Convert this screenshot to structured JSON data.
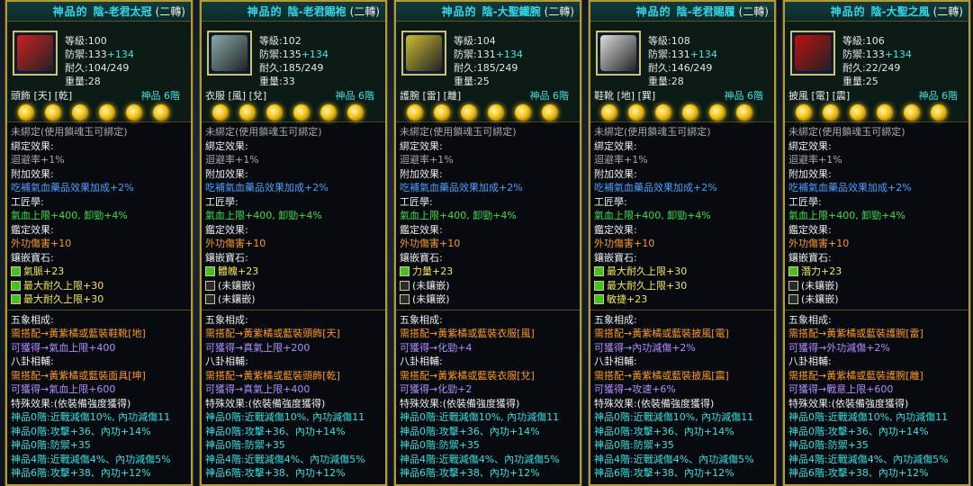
{
  "cards": [
    {
      "quality": "神品的",
      "name": "陰-老君太冠",
      "rebirth": "(二轉)",
      "icon_color": "#c22",
      "stats": {
        "level": "等級:100",
        "def": "防禦:133",
        "def_plus": "+134",
        "dur": "耐久:104/249",
        "weight": "重量:28"
      },
      "slot": "頭飾 [天] [乾]",
      "tier": "神品 6階",
      "unbound": "未綁定(使用鎖魂玉可綁定)",
      "bind_label": "綁定效果:",
      "bind_val": "迴避率+1%",
      "add_label": "附加效果:",
      "add_val": "吃補氣血藥品效果加成+2%",
      "craft_label": "工匠學:",
      "craft_val": "氣血上限+400, 卸勁+4%",
      "ident_label": "鑑定效果:",
      "ident_val": "外功傷害+10",
      "gem_label": "鑲嵌寶石:",
      "gems": [
        {
          "t": "氣脈+23",
          "on": true
        },
        {
          "t": "最大耐久上限+30",
          "on": true
        },
        {
          "t": "最大耐久上限+30",
          "on": true
        }
      ],
      "wx": "五象相成:",
      "wx1": "需搭配→黃紫橘或藍裝鞋靴[地]",
      "wx2": "可獲得→氣血上限+400",
      "bg": "八卦相輔:",
      "bg1": "需搭配→黃紫橘或藍裝面具[坤]",
      "bg2": "可獲得→氣血上限+600",
      "sp": "特殊效果:(依裝備強度獲得)",
      "sps": [
        "神品0階:近戰減傷10%, 內功減傷11",
        "神品0階:攻擊+36、內功+14%",
        "神品0階:防禦+35",
        "神品4階:近戰減傷4%、內功減傷5%",
        "神品6階:攻擊+38、內功+12%"
      ]
    },
    {
      "quality": "神品的",
      "name": "陰-老君賜袍",
      "rebirth": "(二轉)",
      "icon_color": "#8aa",
      "stats": {
        "level": "等級:102",
        "def": "防禦:135",
        "def_plus": "+134",
        "dur": "耐久:185/249",
        "weight": "重量:33"
      },
      "slot": "衣服 [風] [兌]",
      "tier": "神品 6階",
      "unbound": "未綁定(使用鎖魂玉可綁定)",
      "bind_label": "綁定效果:",
      "bind_val": "迴避率+1%",
      "add_label": "附加效果:",
      "add_val": "吃補氣血藥品效果加成+2%",
      "craft_label": "工匠學:",
      "craft_val": "氣血上限+400, 卸勁+4%",
      "ident_label": "鑑定效果:",
      "ident_val": "外功傷害+10",
      "gem_label": "鑲嵌寶石:",
      "gems": [
        {
          "t": "體魄+23",
          "on": true
        },
        {
          "t": "(未鑲嵌)",
          "on": false
        },
        {
          "t": "(未鑲嵌)",
          "on": false
        }
      ],
      "wx": "五象相成:",
      "wx1": "需搭配→黃紫橘或藍裝頭飾[天]",
      "wx2": "可獲得→真氣上限+200",
      "bg": "八卦相輔:",
      "bg1": "需搭配→黃紫橘或藍裝頭飾[乾]",
      "bg2": "可獲得→真氣上限+400",
      "sp": "特殊效果:(依裝備強度獲得)",
      "sps": [
        "神品0階:近戰減傷10%, 內功減傷11",
        "神品0階:攻擊+36、內功+14%",
        "神品0階:防禦+35",
        "神品4階:近戰減傷4%、內功減傷5%",
        "神品6階:攻擊+38、內功+12%"
      ]
    },
    {
      "quality": "神品的",
      "name": "陰-大聖鐵腕",
      "rebirth": "(二轉)",
      "icon_color": "#cb3",
      "stats": {
        "level": "等級:104",
        "def": "防禦:131",
        "def_plus": "+134",
        "dur": "耐久:185/249",
        "weight": "重量:25"
      },
      "slot": "護腕 [雷] [離]",
      "tier": "神品 6階",
      "unbound": "未綁定(使用鎖魂玉可綁定)",
      "bind_label": "綁定效果:",
      "bind_val": "迴避率+1%",
      "add_label": "附加效果:",
      "add_val": "吃補氣血藥品效果加成+2%",
      "craft_label": "工匠學:",
      "craft_val": "氣血上限+400, 卸勁+4%",
      "ident_label": "鑑定效果:",
      "ident_val": "外功傷害+10",
      "gem_label": "鑲嵌寶石:",
      "gems": [
        {
          "t": "力量+23",
          "on": true
        },
        {
          "t": "(未鑲嵌)",
          "on": false
        },
        {
          "t": "(未鑲嵌)",
          "on": false
        }
      ],
      "wx": "五象相成:",
      "wx1": "需搭配→黃紫橘或藍裝衣服[風]",
      "wx2": "可獲得→化勁+4",
      "bg": "八卦相輔:",
      "bg1": "需搭配→黃紫橘或藍裝衣服[兌]",
      "bg2": "可獲得→化勁+2",
      "sp": "特殊效果:(依裝備強度獲得)",
      "sps": [
        "神品0階:近戰減傷10%, 內功減傷11",
        "神品0階:攻擊+36、內功+14%",
        "神品0階:防禦+35",
        "神品4階:近戰減傷4%、內功減傷5%",
        "神品6階:攻擊+38、內功+12%"
      ]
    },
    {
      "quality": "神品的",
      "name": "陰-老君賜履",
      "rebirth": "(二轉)",
      "icon_color": "#ddd",
      "stats": {
        "level": "等級:108",
        "def": "防禦:131",
        "def_plus": "+134",
        "dur": "耐久:146/249",
        "weight": "重量:28"
      },
      "slot": "鞋靴 [地] [巽]",
      "tier": "神品 6階",
      "unbound": "未綁定(使用鎖魂玉可綁定)",
      "bind_label": "綁定效果:",
      "bind_val": "迴避率+1%",
      "add_label": "附加效果:",
      "add_val": "吃補氣血藥品效果加成+2%",
      "craft_label": "工匠學:",
      "craft_val": "氣血上限+400, 卸勁+4%",
      "ident_label": "鑑定效果:",
      "ident_val": "外功傷害+10",
      "gem_label": "鑲嵌寶石:",
      "gems": [
        {
          "t": "最大耐久上限+30",
          "on": true
        },
        {
          "t": "最大耐久上限+30",
          "on": true
        },
        {
          "t": "敏捷+23",
          "on": true
        }
      ],
      "wx": "五象相成:",
      "wx1": "需搭配→黃紫橘或藍裝披風[電]",
      "wx2": "可獲得→內功減傷+2%",
      "bg": "八卦相輔:",
      "bg1": "需搭配→黃紫橘或藍裝披風[震]",
      "bg2": "可獲得→攻速+6%",
      "sp": "特殊效果:(依裝備強度獲得)",
      "sps": [
        "神品0階:近戰減傷10%, 內功減傷11",
        "神品0階:攻擊+36、內功+14%",
        "神品0階:防禦+35",
        "神品4階:近戰減傷4%、內功減傷5%",
        "神品6階:攻擊+38、內功+12%"
      ]
    },
    {
      "quality": "神品的",
      "name": "陰-大聖之風",
      "rebirth": "(二轉)",
      "icon_color": "#b11",
      "stats": {
        "level": "等級:106",
        "def": "防禦:133",
        "def_plus": "+134",
        "dur": "耐久:22/249",
        "weight": "重量:25"
      },
      "slot": "披風 [電] [震]",
      "tier": "神品 6階",
      "unbound": "未綁定(使用鎖魂玉可綁定)",
      "bind_label": "綁定效果:",
      "bind_val": "迴避率+1%",
      "add_label": "附加效果:",
      "add_val": "吃補氣血藥品效果加成+2%",
      "craft_label": "工匠學:",
      "craft_val": "氣血上限+400, 卸勁+4%",
      "ident_label": "鑑定效果:",
      "ident_val": "外功傷害+10",
      "gem_label": "鑲嵌寶石:",
      "gems": [
        {
          "t": "潛力+23",
          "on": true
        },
        {
          "t": "(未鑲嵌)",
          "on": false
        },
        {
          "t": "(未鑲嵌)",
          "on": false
        }
      ],
      "wx": "五象相成:",
      "wx1": "需搭配→黃紫橘或藍裝護腕[雷]",
      "wx2": "可獲得→外功減傷+2%",
      "bg": "八卦相輔:",
      "bg1": "需搭配→黃紫橘或藍裝護腕[離]",
      "bg2": "可獲得→戰意上限+600",
      "sp": "特殊效果:(依裝備強度獲得)",
      "sps": [
        "神品0階:近戰減傷10%, 內功減傷11",
        "神品0階:攻擊+36、內功+14%",
        "神品0階:防禦+35",
        "神品4階:近戰減傷4%、內功減傷5%",
        "神品6階:攻擊+38、內功+12%"
      ]
    }
  ]
}
